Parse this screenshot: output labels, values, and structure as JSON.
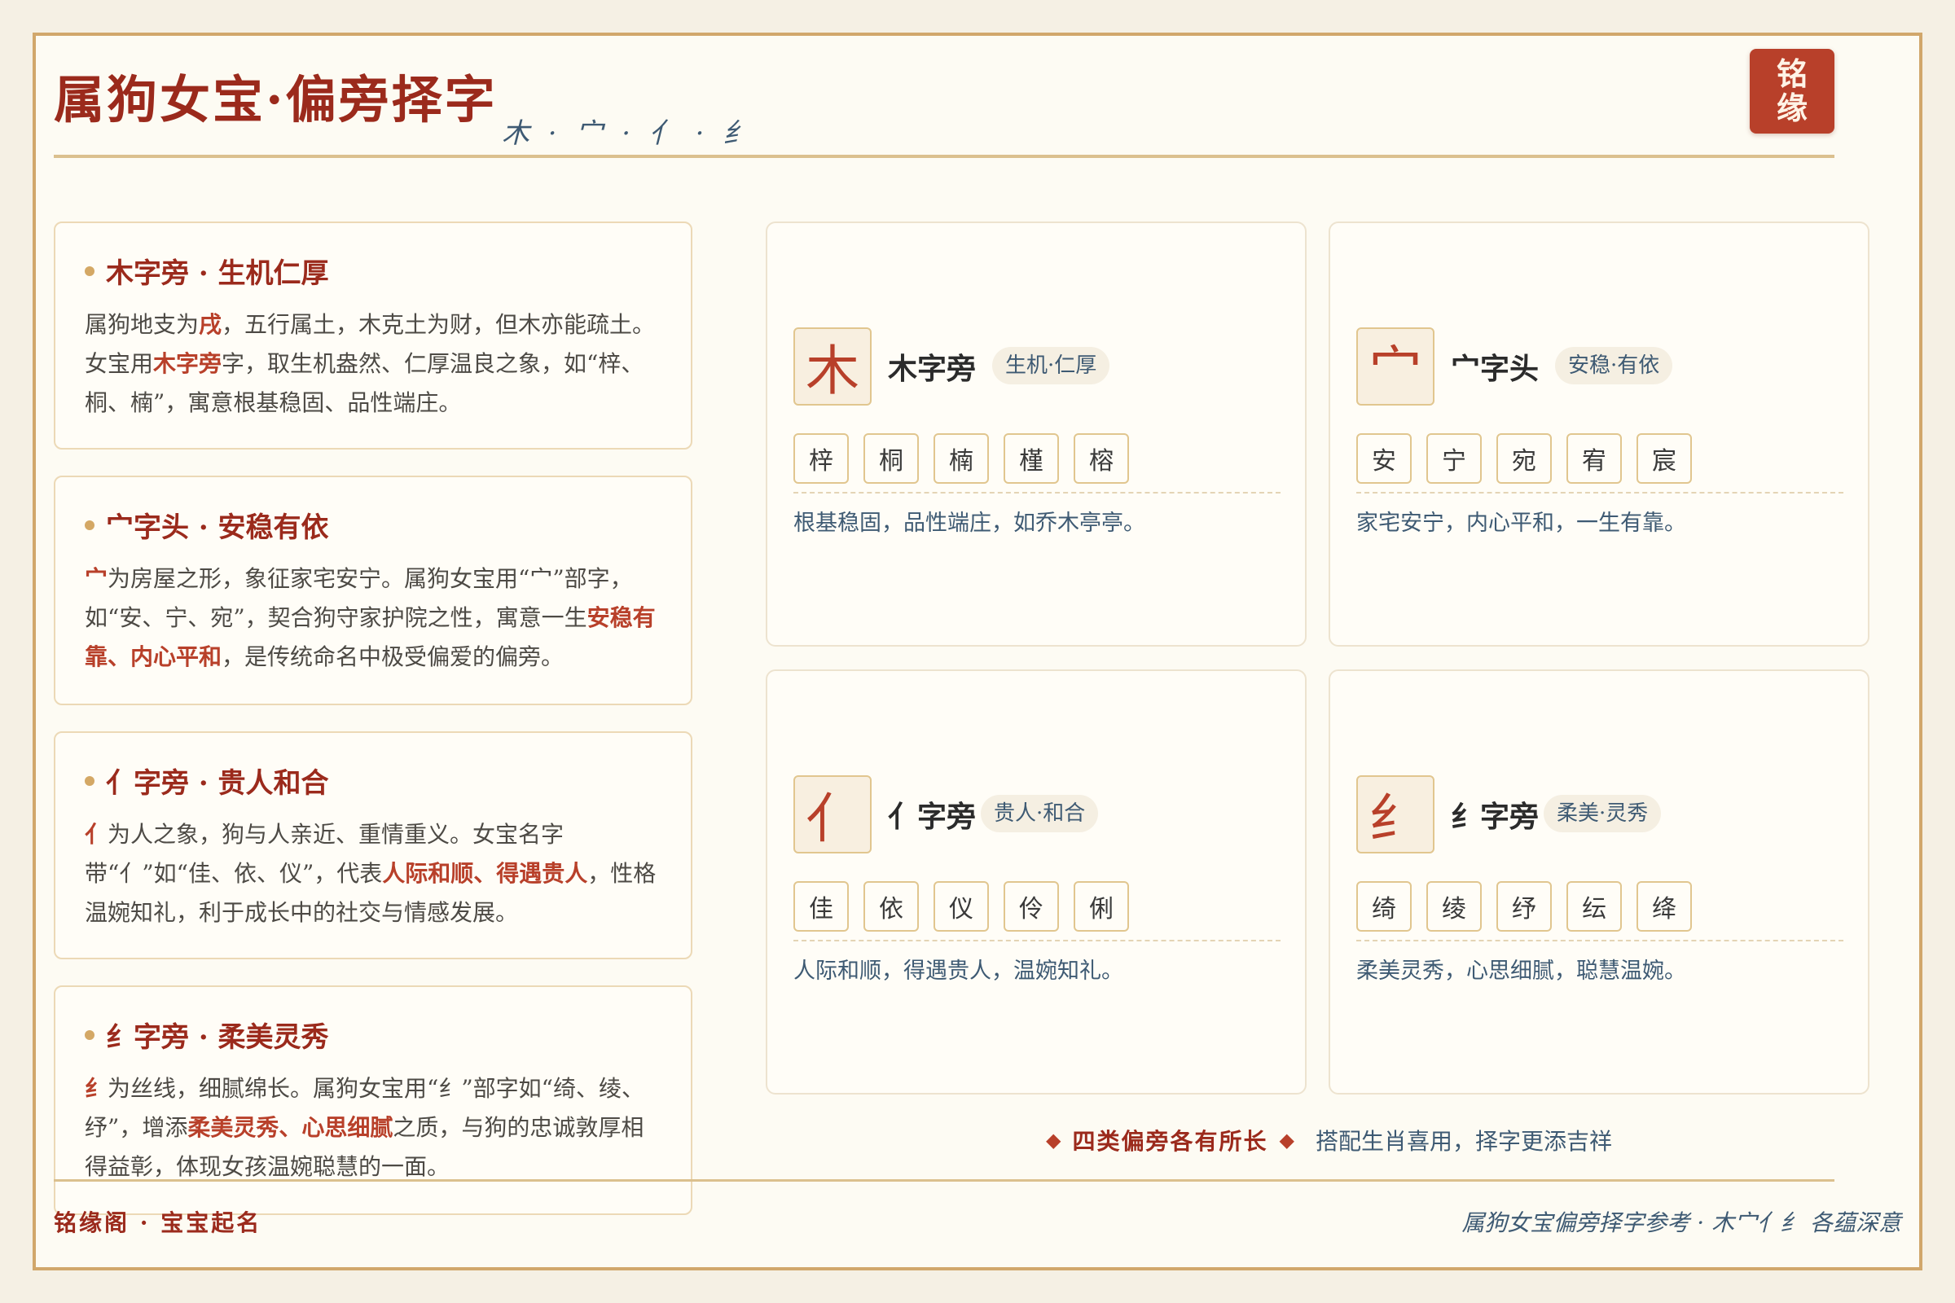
{
  "header": {
    "title": "属狗女宝·偏旁择字",
    "subtitle": "木 · 宀 · 亻 · 纟",
    "seal_line1": "铭",
    "seal_line2": "缘"
  },
  "left_cards": [
    {
      "title": "木字旁 · 生机仁厚",
      "segments": [
        {
          "t": "属狗地支为",
          "h": 0
        },
        {
          "t": "戌",
          "h": 1
        },
        {
          "t": "，五行属土，木克土为财，但木亦能疏土。女宝用",
          "h": 0
        },
        {
          "t": "木字旁",
          "h": 1
        },
        {
          "t": "字，取生机盎然、仁厚温良之象，如“梓、桐、楠”，寓意根基稳固、品性端庄。",
          "h": 0
        }
      ]
    },
    {
      "title": "宀字头 · 安稳有依",
      "segments": [
        {
          "t": "宀",
          "h": 1
        },
        {
          "t": "为房屋之形，象征家宅安宁。属狗女宝用“宀”部字，如“安、宁、宛”，契合狗守家护院之性，寓意一生",
          "h": 0
        },
        {
          "t": "安稳有靠、内心平和",
          "h": 1
        },
        {
          "t": "，是传统命名中极受偏爱的偏旁。",
          "h": 0
        }
      ]
    },
    {
      "title": "亻字旁 · 贵人和合",
      "segments": [
        {
          "t": "亻",
          "h": 1
        },
        {
          "t": "为人之象，狗与人亲近、重情重义。女宝名字带“亻”如“佳、依、仪”，代表",
          "h": 0
        },
        {
          "t": "人际和顺、得遇贵人",
          "h": 1
        },
        {
          "t": "，性格温婉知礼，利于成长中的社交与情感发展。",
          "h": 0
        }
      ]
    },
    {
      "title": "纟字旁 · 柔美灵秀",
      "segments": [
        {
          "t": "纟",
          "h": 1
        },
        {
          "t": "为丝线，细腻绵长。属狗女宝用“纟”部字如“绮、绫、纾”，增添",
          "h": 0
        },
        {
          "t": "柔美灵秀、心思细腻",
          "h": 1
        },
        {
          "t": "之质，与狗的忠诚敦厚相得益彰，体现女孩温婉聪慧的一面。",
          "h": 0
        }
      ]
    }
  ],
  "radical_cards": [
    {
      "radical": "木",
      "title": "木字旁",
      "tag": "生机·仁厚",
      "chars": [
        "梓",
        "桐",
        "楠",
        "槿",
        "榕"
      ],
      "desc": "根基稳固，品性端庄，如乔木亭亭。"
    },
    {
      "radical": "宀",
      "title": "宀字头",
      "tag": "安稳·有依",
      "chars": [
        "安",
        "宁",
        "宛",
        "宥",
        "宸"
      ],
      "desc": "家宅安宁，内心平和，一生有靠。"
    },
    {
      "radical": "亻",
      "title": "亻字旁",
      "tag": "贵人·和合",
      "chars": [
        "佳",
        "依",
        "仪",
        "伶",
        "俐"
      ],
      "desc": "人际和顺，得遇贵人，温婉知礼。"
    },
    {
      "radical": "纟",
      "title": "纟字旁",
      "tag": "柔美·灵秀",
      "chars": [
        "绮",
        "绫",
        "纾",
        "纭",
        "绛"
      ],
      "desc": "柔美灵秀，心思细腻，聪慧温婉。"
    }
  ],
  "summary": {
    "strong": "四类偏旁各有所长",
    "light": "搭配生肖喜用，择字更添吉祥",
    "diamond": "◆"
  },
  "footer": {
    "left": "铭缘阁 · 宝宝起名",
    "right": "属狗女宝偏旁择字参考 · 木宀亻纟 各蕴深意"
  },
  "colors": {
    "accent_red": "#9b2a1c",
    "highlight_red": "#b8402a",
    "gold": "#d1a76b",
    "ink_blue": "#3e5a73",
    "paper": "#fdfbf3"
  }
}
